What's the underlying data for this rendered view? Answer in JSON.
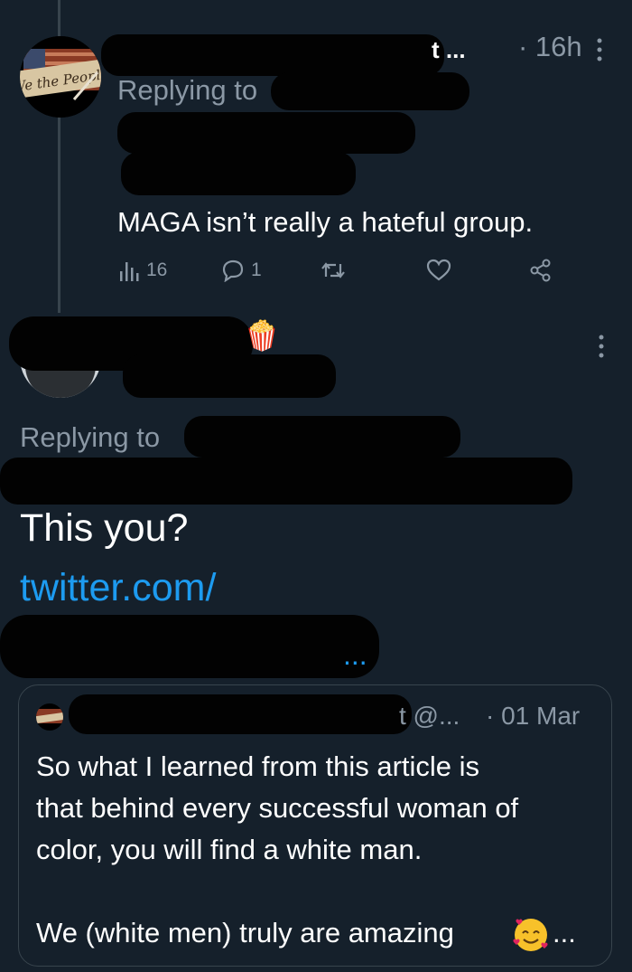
{
  "tweet1": {
    "name_tail": "t ...",
    "time": "· 16h",
    "replying_label": "Replying to",
    "text": "MAGA isn’t really a hateful group.",
    "views_count": "16",
    "reply_count": "1"
  },
  "tweet2": {
    "emoji": "🍿",
    "replying_label": "Replying to",
    "text": "This you?",
    "link_text": "twitter.com/",
    "link_tail": "..."
  },
  "quote": {
    "handle_fragment": "t @...",
    "date": "· 01 Mar",
    "text_line1": "So what I learned from this article is",
    "text_line2": "that behind every successful woman of",
    "text_line3": "color, you will find a white man.",
    "text_line4": "We (white men) truly are amazing",
    "ellipsis": "..."
  },
  "colors": {
    "background": "#15202b",
    "muted": "#8b98a5",
    "link": "#1d9bf0",
    "border": "#38444d"
  },
  "icons": [
    "views-icon",
    "reply-icon",
    "retweet-icon",
    "like-icon",
    "share-icon",
    "more-icon",
    "popcorn-emoji",
    "smiling-hearts-emoji"
  ]
}
